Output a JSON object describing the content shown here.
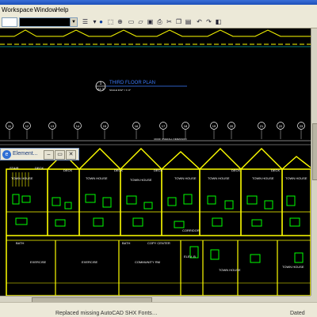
{
  "menu": {
    "items": [
      "Workspace",
      "Window",
      "Help"
    ]
  },
  "panel": {
    "title": "Element..."
  },
  "drawing": {
    "view_title": "THIRD FLOOR PLAN",
    "view_scale": "SCALE 3/32\" = 1'-0\"",
    "tag_number": "1",
    "tag_sheet": "A1.3",
    "dim_text": "ROOF OVERALL DIMENSION",
    "gridlines": [
      "11",
      "12",
      "13",
      "14",
      "15",
      "16",
      "17",
      "18",
      "19",
      "20",
      "21",
      "22",
      "23"
    ],
    "rooms": {
      "deck": "DECK",
      "deck_short": "DECK",
      "town_house": "TOWN HOUSE",
      "stair": "STAIR",
      "bath": "BATH",
      "exercise": "EXERCISE",
      "community": "COMMUNITY RM",
      "copy_center": "COPY CENTER",
      "corridor": "CORRIDOR",
      "elev_b": "ELEV. B"
    }
  },
  "status": {
    "message": "Replaced missing AutoCAD SHX Fonts…",
    "right_text": "Dated"
  },
  "colors": {
    "canvas_bg": "#000000",
    "line_yellow": "#ffff00",
    "line_green": "#00ff00",
    "line_cyan": "#00ffff",
    "line_white": "#ffffff",
    "line_blue": "#3c7cff"
  }
}
